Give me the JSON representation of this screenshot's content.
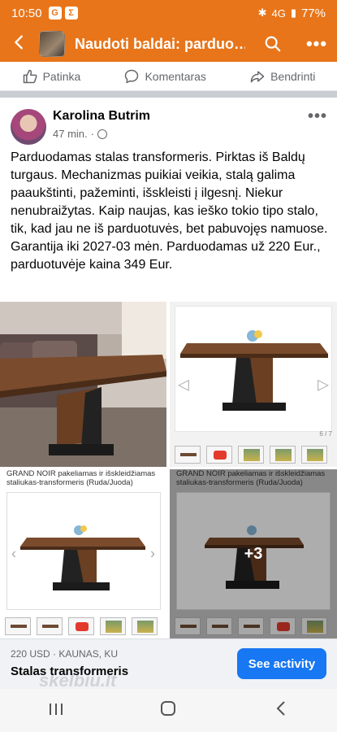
{
  "status_bar": {
    "time": "10:50",
    "battery": "77%",
    "network": "4G",
    "app_icons": [
      "G",
      "Σ"
    ]
  },
  "app_bar": {
    "back_icon": "arrow-left-icon",
    "title": "Naudoti baldai: parduo…",
    "search_icon": "search-icon",
    "more_icon": "more-icon"
  },
  "action_bar": {
    "like_label": "Patinka",
    "comment_label": "Komentaras",
    "share_label": "Bendrinti"
  },
  "post": {
    "author": "Karolina Butrim",
    "time": "47 min.",
    "separator": "·",
    "text": "Parduodamas stalas transformeris. Pirktas iš Baldų turgaus. Mechanizmas puikiai veikia, stalą galima paaukštinti, pažeminti, išskleisti į ilgesnį. Niekur nenubraižytas. Kaip naujas, kas ieško tokio tipo stalo, tik, kad jau ne iš parduotuvės, bet pabuvojęs namuose. Garantija iki 2027-03 mėn. Parduodamas už 220 Eur., parduotuvėje kaina 349 Eur.",
    "photos": {
      "p2_counter": "6 / 7",
      "p3_caption": "GRAND NOIR pakeliamas ir išskleidžiamas staliukas-transformeris (Ruda/Juoda)",
      "p4_caption": "GRAND NOIR pakeliamas ir išskleidžiamas staliukas-transformeris (Ruda/Juoda)",
      "more_count": "+3"
    }
  },
  "sale_bar": {
    "price_location": "220 USD · KAUNAS, KU",
    "item_title": "Stalas transformeris",
    "button_label": "See activity"
  },
  "watermark": "skelbiu.lt",
  "colors": {
    "brand": "#e8751a",
    "button": "#1877f2"
  }
}
